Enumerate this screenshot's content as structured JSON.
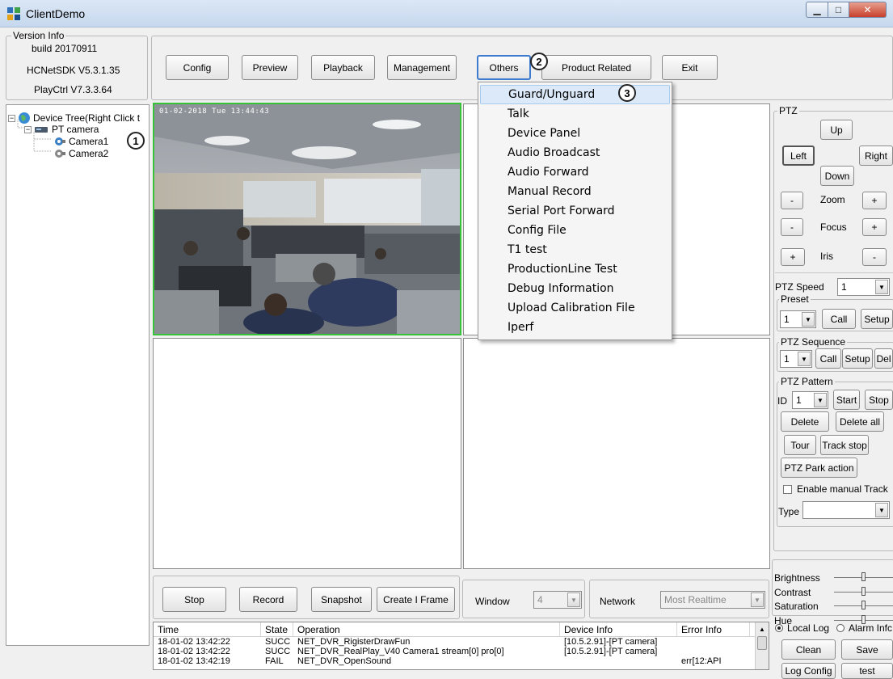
{
  "window": {
    "title": "ClientDemo"
  },
  "version_info": {
    "group_title": "Version Info",
    "build": "build 20170911",
    "sdk": "HCNetSDK V5.3.1.35",
    "playctrl": "PlayCtrl V7.3.3.64"
  },
  "toolbar": {
    "config": "Config",
    "preview": "Preview",
    "playback": "Playback",
    "management": "Management",
    "others": "Others",
    "product_related": "Product Related",
    "exit": "Exit"
  },
  "tree": {
    "root": "Device Tree(Right Click t",
    "device": "PT camera",
    "camera1": "Camera1",
    "camera2": "Camera2"
  },
  "callouts": {
    "one": "1",
    "two": "2",
    "three": "3"
  },
  "video": {
    "timestamp": "01-02-2018 Tue 13:44:43"
  },
  "others_menu": [
    "Guard/Unguard",
    "Talk",
    "Device Panel",
    "Audio Broadcast",
    "Audio Forward",
    "Manual Record",
    "Serial Port Forward",
    "Config File",
    "T1 test",
    "ProductionLine Test",
    "Debug Information",
    "Upload Calibration File",
    "Iperf"
  ],
  "bottom_controls": {
    "stop": "Stop",
    "record": "Record",
    "snapshot": "Snapshot",
    "create_i_frame": "Create I Frame",
    "window_label": "Window",
    "window_value": "4",
    "network_label": "Network",
    "network_value": "Most Realtime"
  },
  "log": {
    "headers": [
      "Time",
      "State",
      "Operation",
      "Device Info",
      "Error Info"
    ],
    "rows": [
      {
        "time": "18-01-02 13:42:22",
        "state": "SUCC",
        "op": "NET_DVR_RigisterDrawFun",
        "dev": "[10.5.2.91]-[PT camera]",
        "err": ""
      },
      {
        "time": "18-01-02 13:42:22",
        "state": "SUCC",
        "op": "NET_DVR_RealPlay_V40 Camera1 stream[0] pro[0]",
        "dev": "[10.5.2.91]-[PT camera]",
        "err": ""
      },
      {
        "time": "18-01-02 13:42:19",
        "state": "FAIL",
        "op": "NET_DVR_OpenSound",
        "dev": "",
        "err": "err[12:API"
      }
    ]
  },
  "ptz": {
    "title": "PTZ",
    "up": "Up",
    "left": "Left",
    "right": "Right",
    "down": "Down",
    "minus": "-",
    "plus": "+",
    "zoom": "Zoom",
    "focus": "Focus",
    "iris": "Iris",
    "speed_label": "PTZ Speed",
    "speed_value": "1",
    "preset_title": "Preset",
    "preset_value": "1",
    "call": "Call",
    "setup": "Setup",
    "sequence_title": "PTZ Sequence",
    "sequence_value": "1",
    "del": "Del",
    "pattern_title": "PTZ Pattern",
    "id_label": "ID",
    "id_value": "1",
    "start": "Start",
    "stop": "Stop",
    "delete": "Delete",
    "delete_all": "Delete all",
    "tour": "Tour",
    "track_stop": "Track stop",
    "park_action": "PTZ Park action",
    "enable_manual_track": "Enable manual Track",
    "type_label": "Type"
  },
  "image": {
    "brightness": "Brightness",
    "contrast": "Contrast",
    "saturation": "Saturation",
    "hue": "Hue"
  },
  "log_panel": {
    "local_log": "Local Log",
    "alarm_info": "Alarm Infc",
    "clean": "Clean",
    "save": "Save",
    "log_config": "Log Config",
    "test": "test"
  }
}
